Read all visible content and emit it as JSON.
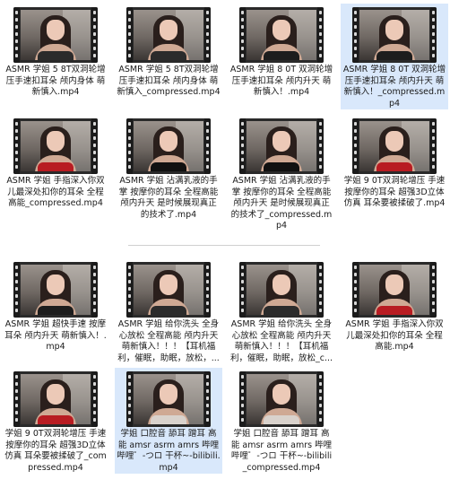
{
  "group1": [
    {
      "name": "ASMR 学姐 5 8T双洞轮增压手速扣耳朵 颅内身体 萌新慎入.mp4",
      "top_color": "#2b2b2b",
      "selected": false
    },
    {
      "name": "ASMR 学姐 5 8T双洞轮增压手速扣耳朵 颅内身体 萌新慎入_compressed.mp4",
      "top_color": "#2b2b2b",
      "selected": false
    },
    {
      "name": "ASMR 学姐 8 0T 双洞轮增压手速扣耳朵 颅内升天 萌新慎入！.mp4",
      "top_color": "#1d1d1d",
      "selected": false
    },
    {
      "name": "ASMR 学姐 8 0T 双洞轮增压手速扣耳朵 颅内升天 萌新慎入！_compressed.mp4",
      "top_color": "#1d1d1d",
      "selected": true
    },
    {
      "name": "ASMR 学姐 手指深入你双儿最深处扣你的耳朵 全程高能_compressed.mp4",
      "top_color": "#b81c22",
      "selected": false
    },
    {
      "name": "ASMR 学姐 沾满乳液的手掌 按摩你的耳朵 全程高能 颅内升天 是时候展现真正的技术了.mp4",
      "top_color": "#111111",
      "selected": false
    },
    {
      "name": "ASMR 学姐 沾满乳液的手掌 按摩你的耳朵 全程高能 颅内升天 是时候展现真正的技术了_compressed.mp4",
      "top_color": "#111111",
      "selected": false
    },
    {
      "name": "学姐 9 0T双洞轮增压 手速按摩你的耳朵 超强3D立体仿真 耳朵要被揉破了.mp4",
      "top_color": "#b81c22",
      "selected": false
    }
  ],
  "group2": [
    {
      "name": "ASMR 学姐 超快手速 按摩耳朵 颅内升天 萌新慎入！.mp4",
      "top_color": "#1d1d1d",
      "selected": false
    },
    {
      "name": "ASMR 学姐 给你洗头 全身心放松 全程高能 颅内升天 萌新慎入！！！【耳机福利，催眠，助眠，放松，...",
      "top_color": "#2b2b2b",
      "selected": false
    },
    {
      "name": "ASMR 学姐 给你洗头 全身心放松 全程高能 颅内升天 萌新慎入！！！【耳机福利，催眠，助眠，放松_c...",
      "top_color": "#2b2b2b",
      "selected": false
    },
    {
      "name": "ASMR 学姐 手指深入你双儿最深处扣你的耳朵 全程高能.mp4",
      "top_color": "#b81c22",
      "selected": false
    },
    {
      "name": "学姐 9 0T双洞轮增压 手速按摩你的耳朵 超强3D立体仿真 耳朵要被揉破了_compressed.mp4",
      "top_color": "#b81c22",
      "selected": false
    },
    {
      "name": "学姐 口腔音 舔耳 蹭耳 高能 amsr asrm amrs 哔哩哔哩゜-つロ 干杯~-bilibili.mp4",
      "top_color": "#d9d2cc",
      "selected": true
    },
    {
      "name": "学姐 口腔音 舔耳 蹭耳 高能 amsr asrm amrs 哔哩哔哩゜-つロ 干杯~-bilibili_compressed.mp4",
      "top_color": "#d9d2cc",
      "selected": false
    }
  ]
}
